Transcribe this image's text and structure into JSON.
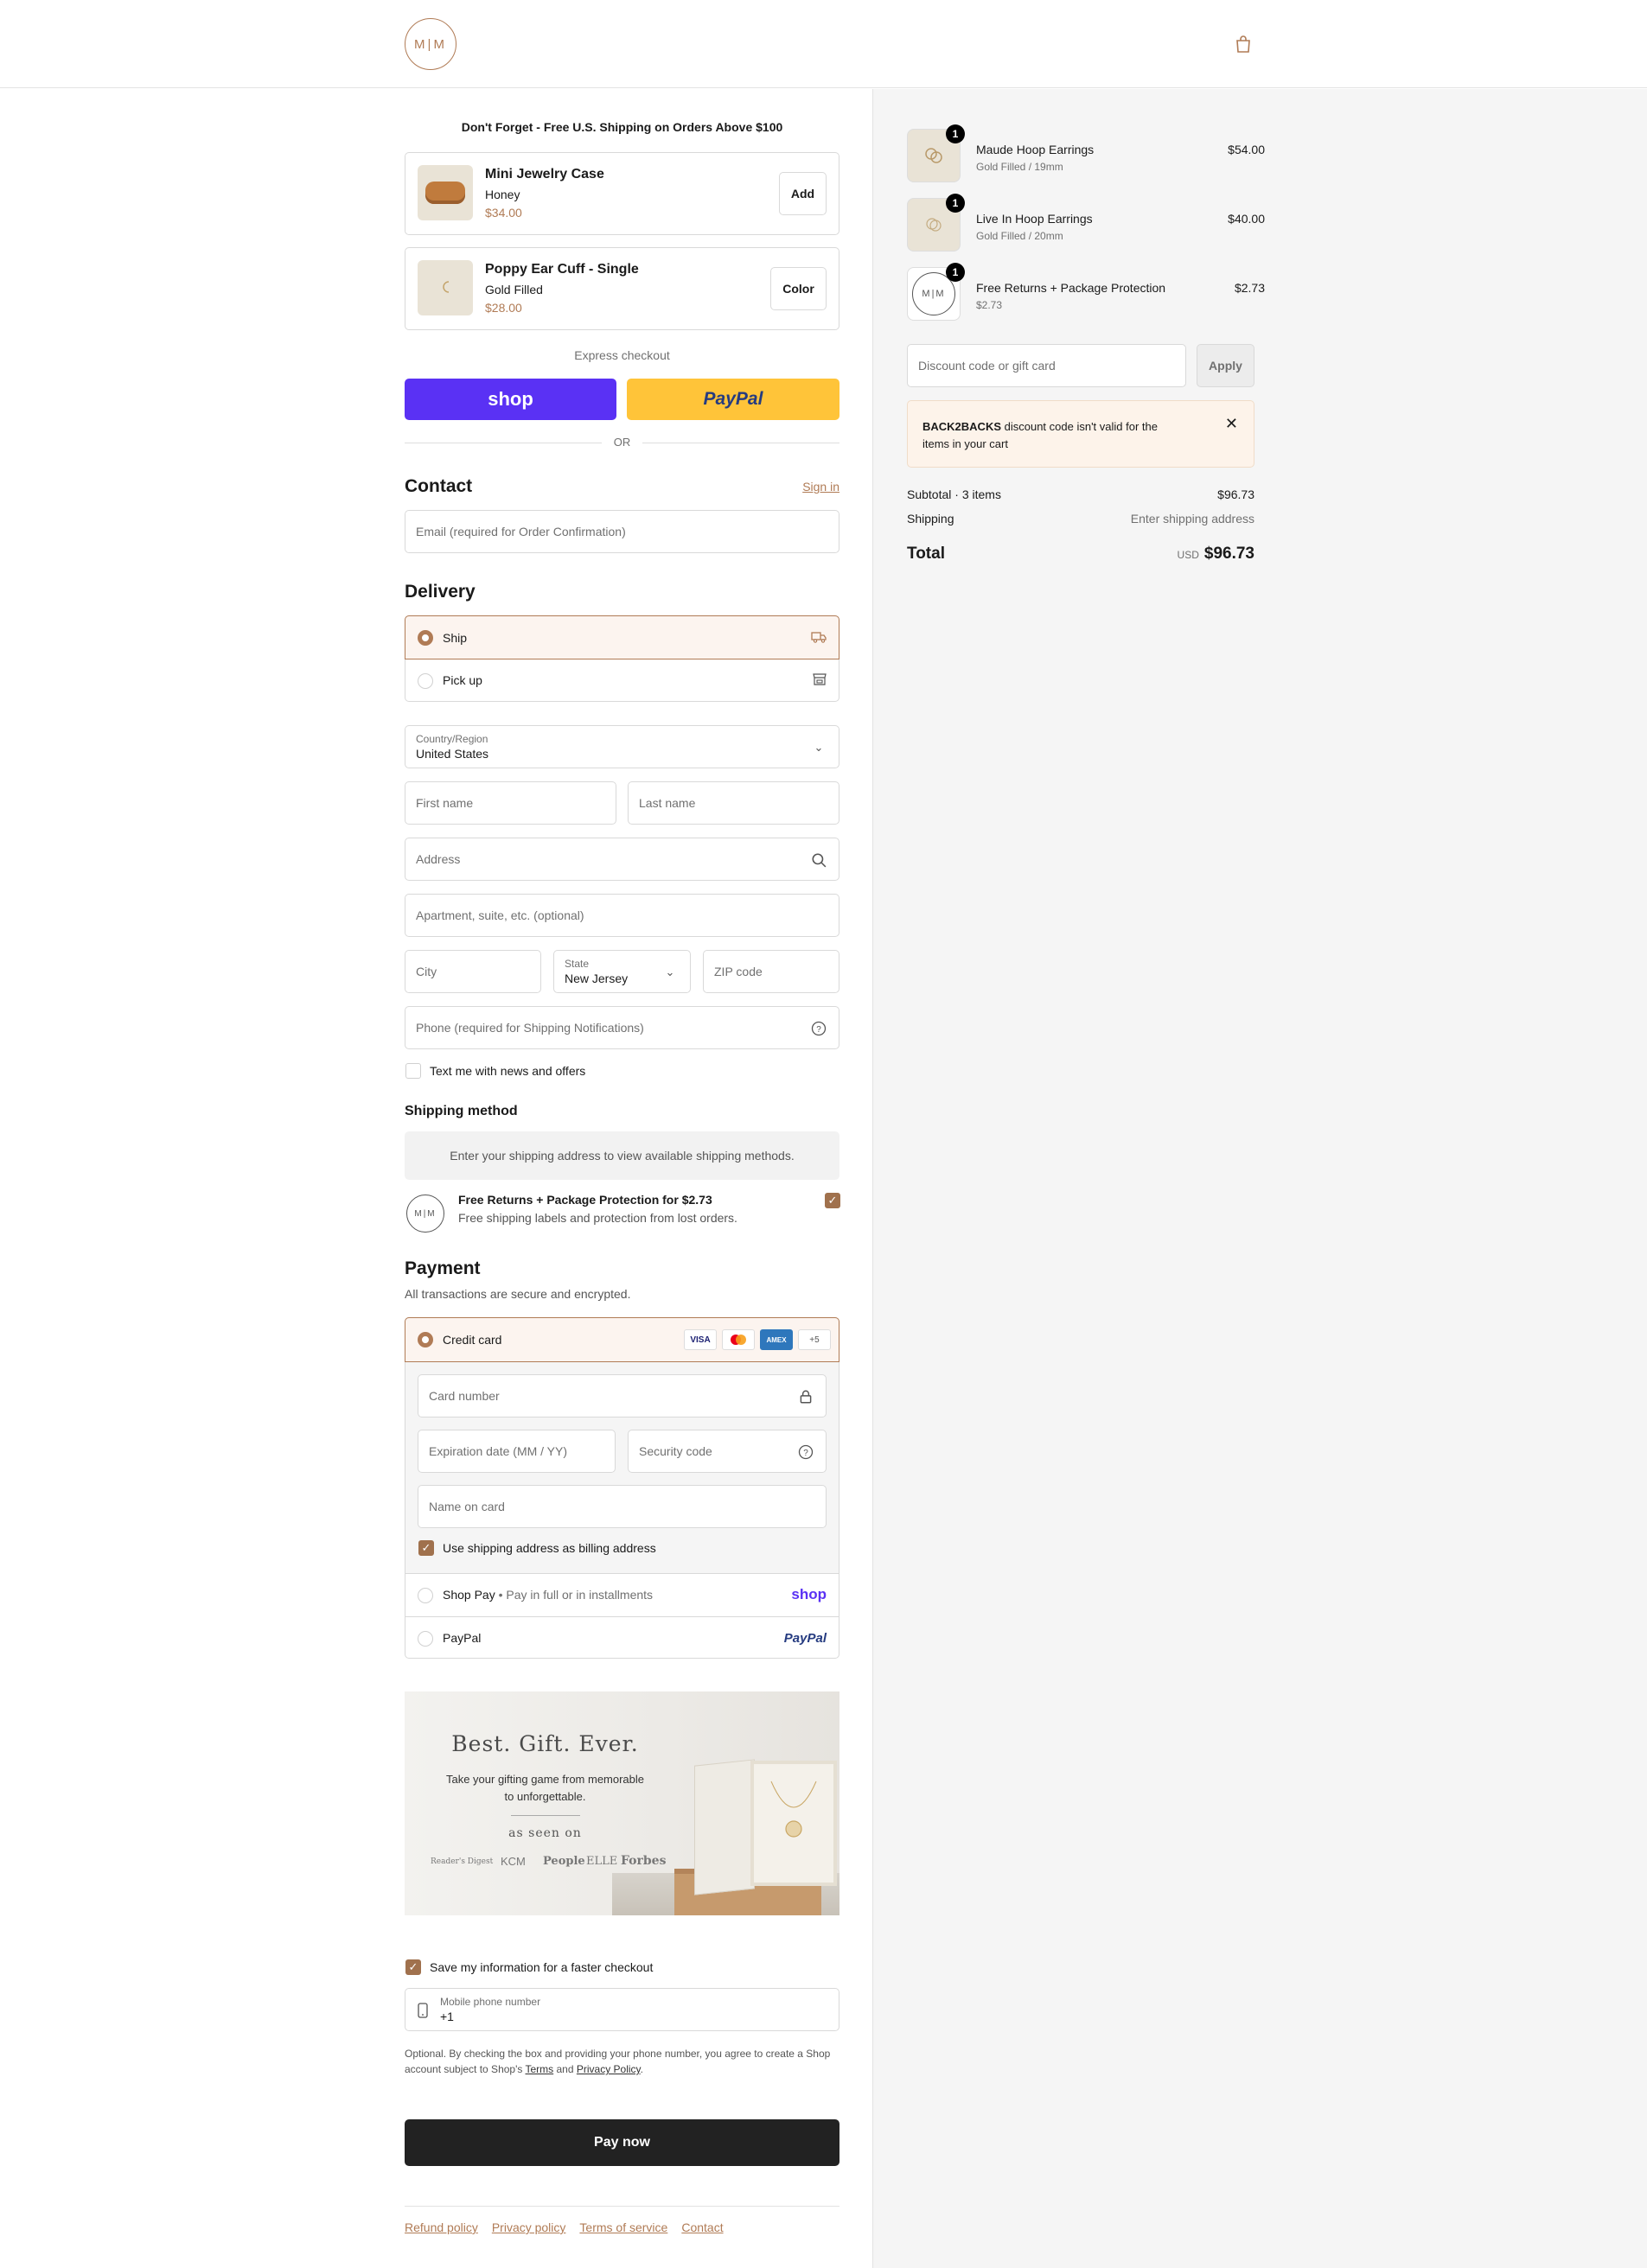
{
  "header": {
    "logo_text": "M|M",
    "cart_icon": "shopping-bag-icon"
  },
  "promo": {
    "title": "Don't Forget - Free U.S. Shipping on Orders Above $100",
    "items": [
      {
        "title": "Mini Jewelry Case",
        "variant": "Honey",
        "price": "$34.00",
        "button": "Add"
      },
      {
        "title": "Poppy Ear Cuff - Single",
        "variant": "Gold Filled",
        "price": "$28.00",
        "button": "Color"
      }
    ]
  },
  "express": {
    "label": "Express checkout",
    "shop_label": "shop",
    "paypal_label": "PayPal",
    "or_label": "OR"
  },
  "contact": {
    "heading": "Contact",
    "signin_label": "Sign in",
    "email_placeholder": "Email (required for Order Confirmation)"
  },
  "delivery": {
    "heading": "Delivery",
    "options": [
      {
        "label": "Ship",
        "selected": true
      },
      {
        "label": "Pick up",
        "selected": false
      }
    ],
    "country_label": "Country/Region",
    "country_value": "United States",
    "first_name_placeholder": "First name",
    "last_name_placeholder": "Last name",
    "address_placeholder": "Address",
    "apartment_placeholder": "Apartment, suite, etc. (optional)",
    "city_placeholder": "City",
    "state_label": "State",
    "state_value": "New Jersey",
    "zip_placeholder": "ZIP code",
    "phone_placeholder": "Phone (required for Shipping Notifications)",
    "text_me_label": "Text me with news and offers"
  },
  "shipping_method": {
    "heading": "Shipping method",
    "notice": "Enter your shipping address to view available shipping methods.",
    "protection_title": "Free Returns + Package Protection for $2.73",
    "protection_desc": "Free shipping labels and protection from lost orders."
  },
  "payment": {
    "heading": "Payment",
    "subtitle": "All transactions are secure and encrypted.",
    "credit_card_label": "Credit card",
    "card_brands": [
      "VISA",
      "MC",
      "AMEX",
      "+5"
    ],
    "card_number_placeholder": "Card number",
    "expiration_placeholder": "Expiration date (MM / YY)",
    "security_placeholder": "Security code",
    "name_placeholder": "Name on card",
    "billing_same_label": "Use shipping address as billing address",
    "shop_pay_label": "Shop Pay",
    "shop_pay_sub": "Pay in full or in installments",
    "shop_pay_logo": "shop",
    "paypal_label": "PayPal",
    "paypal_logo": "PayPal"
  },
  "banner": {
    "title": "Best. Gift. Ever.",
    "line1": "Take your gifting game from memorable",
    "line2": "to unforgettable.",
    "seen_on": "as seen on",
    "press": [
      "Reader's Digest",
      "KCM",
      "People",
      "ELLE",
      "Forbes"
    ]
  },
  "save_info": {
    "label": "Save my information for a faster checkout",
    "mobile_label": "Mobile phone number",
    "mobile_value": "+1",
    "legal_1": "Optional. By checking the box and providing your phone number, you agree to create a Shop",
    "legal_2a": "account subject to Shop's ",
    "terms_link": "Terms",
    "legal_and": " and ",
    "privacy_link": "Privacy Policy",
    "legal_end": "."
  },
  "pay_button": "Pay now",
  "footer_links": [
    "Refund policy",
    "Privacy policy",
    "Terms of service",
    "Contact"
  ],
  "summary": {
    "items": [
      {
        "name": "Maude Hoop Earrings",
        "variant": "Gold Filled / 19mm",
        "price": "$54.00",
        "qty": "1"
      },
      {
        "name": "Live In Hoop Earrings",
        "variant": "Gold Filled / 20mm",
        "price": "$40.00",
        "qty": "1"
      },
      {
        "name": "Free Returns + Package Protection",
        "variant": "$2.73",
        "price": "$2.73",
        "qty": "1"
      }
    ],
    "discount_placeholder": "Discount code or gift card",
    "apply_label": "Apply",
    "alert_code": "BACK2BACKS",
    "alert_text_1": " discount code isn't valid for the",
    "alert_text_2": "items in your cart",
    "subtotal_label": "Subtotal · 3 items",
    "subtotal_value": "$96.73",
    "shipping_label": "Shipping",
    "shipping_value": "Enter shipping address",
    "total_label": "Total",
    "currency": "USD",
    "total_value": "$96.73"
  },
  "colors": {
    "accent": "#b07b55",
    "shop": "#5a31f4",
    "paypal": "#ffc439",
    "pay_button": "#222222"
  }
}
